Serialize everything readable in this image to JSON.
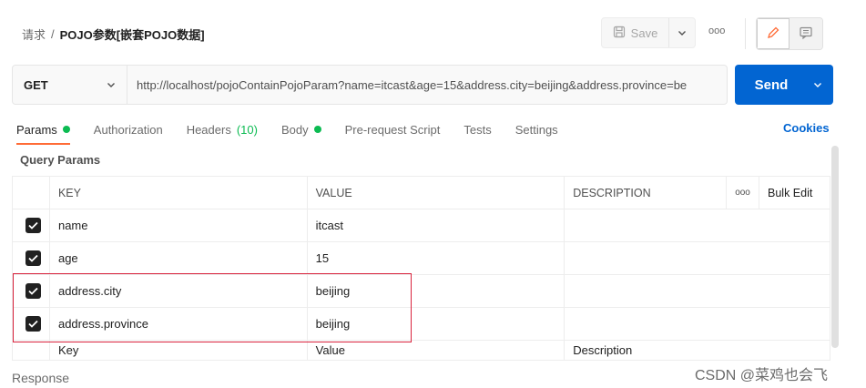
{
  "breadcrumb": {
    "parent": "请求",
    "separator": "/",
    "current": "POJO参数[嵌套POJO数据]"
  },
  "toolbar": {
    "save_label": "Save",
    "more": "ooo"
  },
  "request": {
    "method": "GET",
    "url": "http://localhost/pojoContainPojoParam?name=itcast&age=15&address.city=beijing&address.province=be",
    "send_label": "Send"
  },
  "tabs": [
    {
      "label": "Params",
      "active": true,
      "dot": true
    },
    {
      "label": "Authorization"
    },
    {
      "label": "Headers",
      "count": "(10)"
    },
    {
      "label": "Body",
      "dot": true
    },
    {
      "label": "Pre-request Script"
    },
    {
      "label": "Tests"
    },
    {
      "label": "Settings"
    }
  ],
  "cookies_label": "Cookies",
  "query_params_label": "Query Params",
  "table": {
    "headers": {
      "key": "KEY",
      "value": "VALUE",
      "description": "DESCRIPTION",
      "more": "ooo",
      "bulk_edit": "Bulk Edit"
    },
    "rows": [
      {
        "key": "name",
        "value": "itcast",
        "checked": true
      },
      {
        "key": "age",
        "value": "15",
        "checked": true
      },
      {
        "key": "address.city",
        "value": "beijing",
        "checked": true
      },
      {
        "key": "address.province",
        "value": "beijing",
        "checked": true
      }
    ],
    "placeholders": {
      "key": "Key",
      "value": "Value",
      "description": "Description"
    }
  },
  "response_label": "Response",
  "watermark": "CSDN @菜鸡也会飞",
  "colors": {
    "send_blue": "#0265d2",
    "active_tab_underline": "#ff6c37",
    "green_dot": "#0cbb52",
    "highlight_red": "#d9243d"
  }
}
